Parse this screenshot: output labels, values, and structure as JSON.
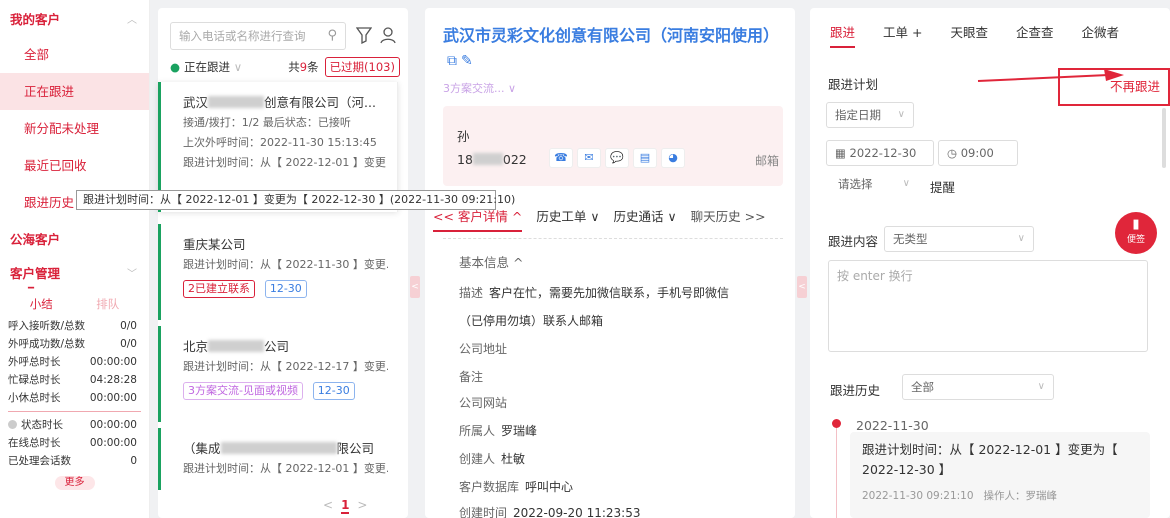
{
  "sidebar": {
    "my_customers": "我的客户",
    "items": [
      {
        "label": "全部"
      },
      {
        "label": "正在跟进"
      },
      {
        "label": "新分配未处理"
      },
      {
        "label": "最近已回收"
      },
      {
        "label": "跟进历史"
      }
    ],
    "public_customers": "公海客户",
    "customer_mgmt": "客户管理",
    "tab_summary": "小结",
    "tab_queue": "排队",
    "stats": [
      {
        "label": "呼入接听数/总数",
        "value": "0/0"
      },
      {
        "label": "外呼成功数/总数",
        "value": "0/0"
      },
      {
        "label": "外呼总时长",
        "value": "00:00:00"
      },
      {
        "label": "忙碌总时长",
        "value": "04:28:28"
      },
      {
        "label": "小休总时长",
        "value": "00:00:00"
      }
    ],
    "stats2": [
      {
        "label": "状态时长",
        "value": "00:00:00"
      },
      {
        "label": "在线总时长",
        "value": "00:00:00"
      },
      {
        "label": "已处理会话数",
        "value": "0"
      }
    ],
    "more": "更多"
  },
  "list": {
    "search_placeholder": "输入电话或名称进行查询",
    "status": "正在跟进",
    "count_prefix": "共",
    "count": "9",
    "count_suffix": "条",
    "overdue": "已过期(103)",
    "cards": [
      {
        "name_prefix": "武汉",
        "name_suffix": "创意有限公司（河...",
        "line1": "接通/拨打：1/2   最后状态：已接听",
        "line2": "上次外呼时间：2022-11-30 15:13:45",
        "line3": "跟进计划时间：从【 2022-12-01 】变更..."
      },
      {
        "name": "重庆某公司",
        "line1": "跟进计划时间：从【 2022-11-30 】变更...",
        "tag1": "2已建立联系",
        "tag2": "12-30"
      },
      {
        "name_prefix": "北京",
        "name_suffix": "公司",
        "line1": "跟进计划时间：从【 2022-12-17 】变更...",
        "tag1": "3方案交流-见面或视频",
        "tag2": "12-30"
      },
      {
        "name_prefix": "（集成",
        "name_suffix": "限公司",
        "line1": "跟进计划时间：从【 2022-12-01 】变更..."
      }
    ],
    "page": "1"
  },
  "tooltip": "跟进计划时间：从【 2022-12-01 】变更为【 2022-12-30 】(2022-11-30 09:21:10)",
  "detail": {
    "title": "武汉市灵彩文化创意有限公司（河南安阳使用）",
    "stage": "3方案交流...",
    "contact_name": "孙",
    "phone_prefix": "18",
    "phone_suffix": "022",
    "mail": "邮箱",
    "tabs": [
      "<< 客户详情 ^",
      "历史工单 ∨",
      "历史通话 ∨",
      "聊天历史 >>"
    ],
    "basic_info": "基本信息 ^",
    "fields": [
      {
        "label": "描述",
        "value": "客户在忙，需要先加微信联系，手机号即微信"
      },
      {
        "label": "",
        "value": "（已停用勿填）联系人邮箱"
      },
      {
        "label": "公司地址",
        "value": ""
      },
      {
        "label": "备注",
        "value": ""
      },
      {
        "label": "公司网站",
        "value": ""
      },
      {
        "label": "所属人",
        "value": "罗瑞峰"
      },
      {
        "label": "创建人",
        "value": "杜敏"
      },
      {
        "label": "客户数据库",
        "value": "呼叫中心"
      },
      {
        "label": "创建时间",
        "value": "2022-09-20 11:23:53"
      }
    ]
  },
  "followup": {
    "tabs": [
      "跟进",
      "工单 +",
      "天眼查",
      "企查查",
      "企微者"
    ],
    "plan_label": "跟进计划",
    "stop": "不再跟进",
    "date_mode": "指定日期",
    "date": "2022-12-30",
    "time": "09:00",
    "select_placeholder": "请选择",
    "remind": "提醒",
    "content_label": "跟进内容",
    "content_type": "无类型",
    "textarea_placeholder": "按 enter 换行",
    "fab": "便签",
    "history_label": "跟进历史",
    "history_filter": "全部",
    "history": [
      {
        "date": "2022-11-30",
        "text": "跟进计划时间：从【 2022-12-01 】变更为【 2022-12-30 】",
        "time": "2022-11-30 09:21:10",
        "operator": "操作人：罗瑞峰"
      }
    ]
  },
  "colors": {
    "accent": "#d9213a",
    "link": "#3a7de0",
    "green": "#1aa260"
  }
}
